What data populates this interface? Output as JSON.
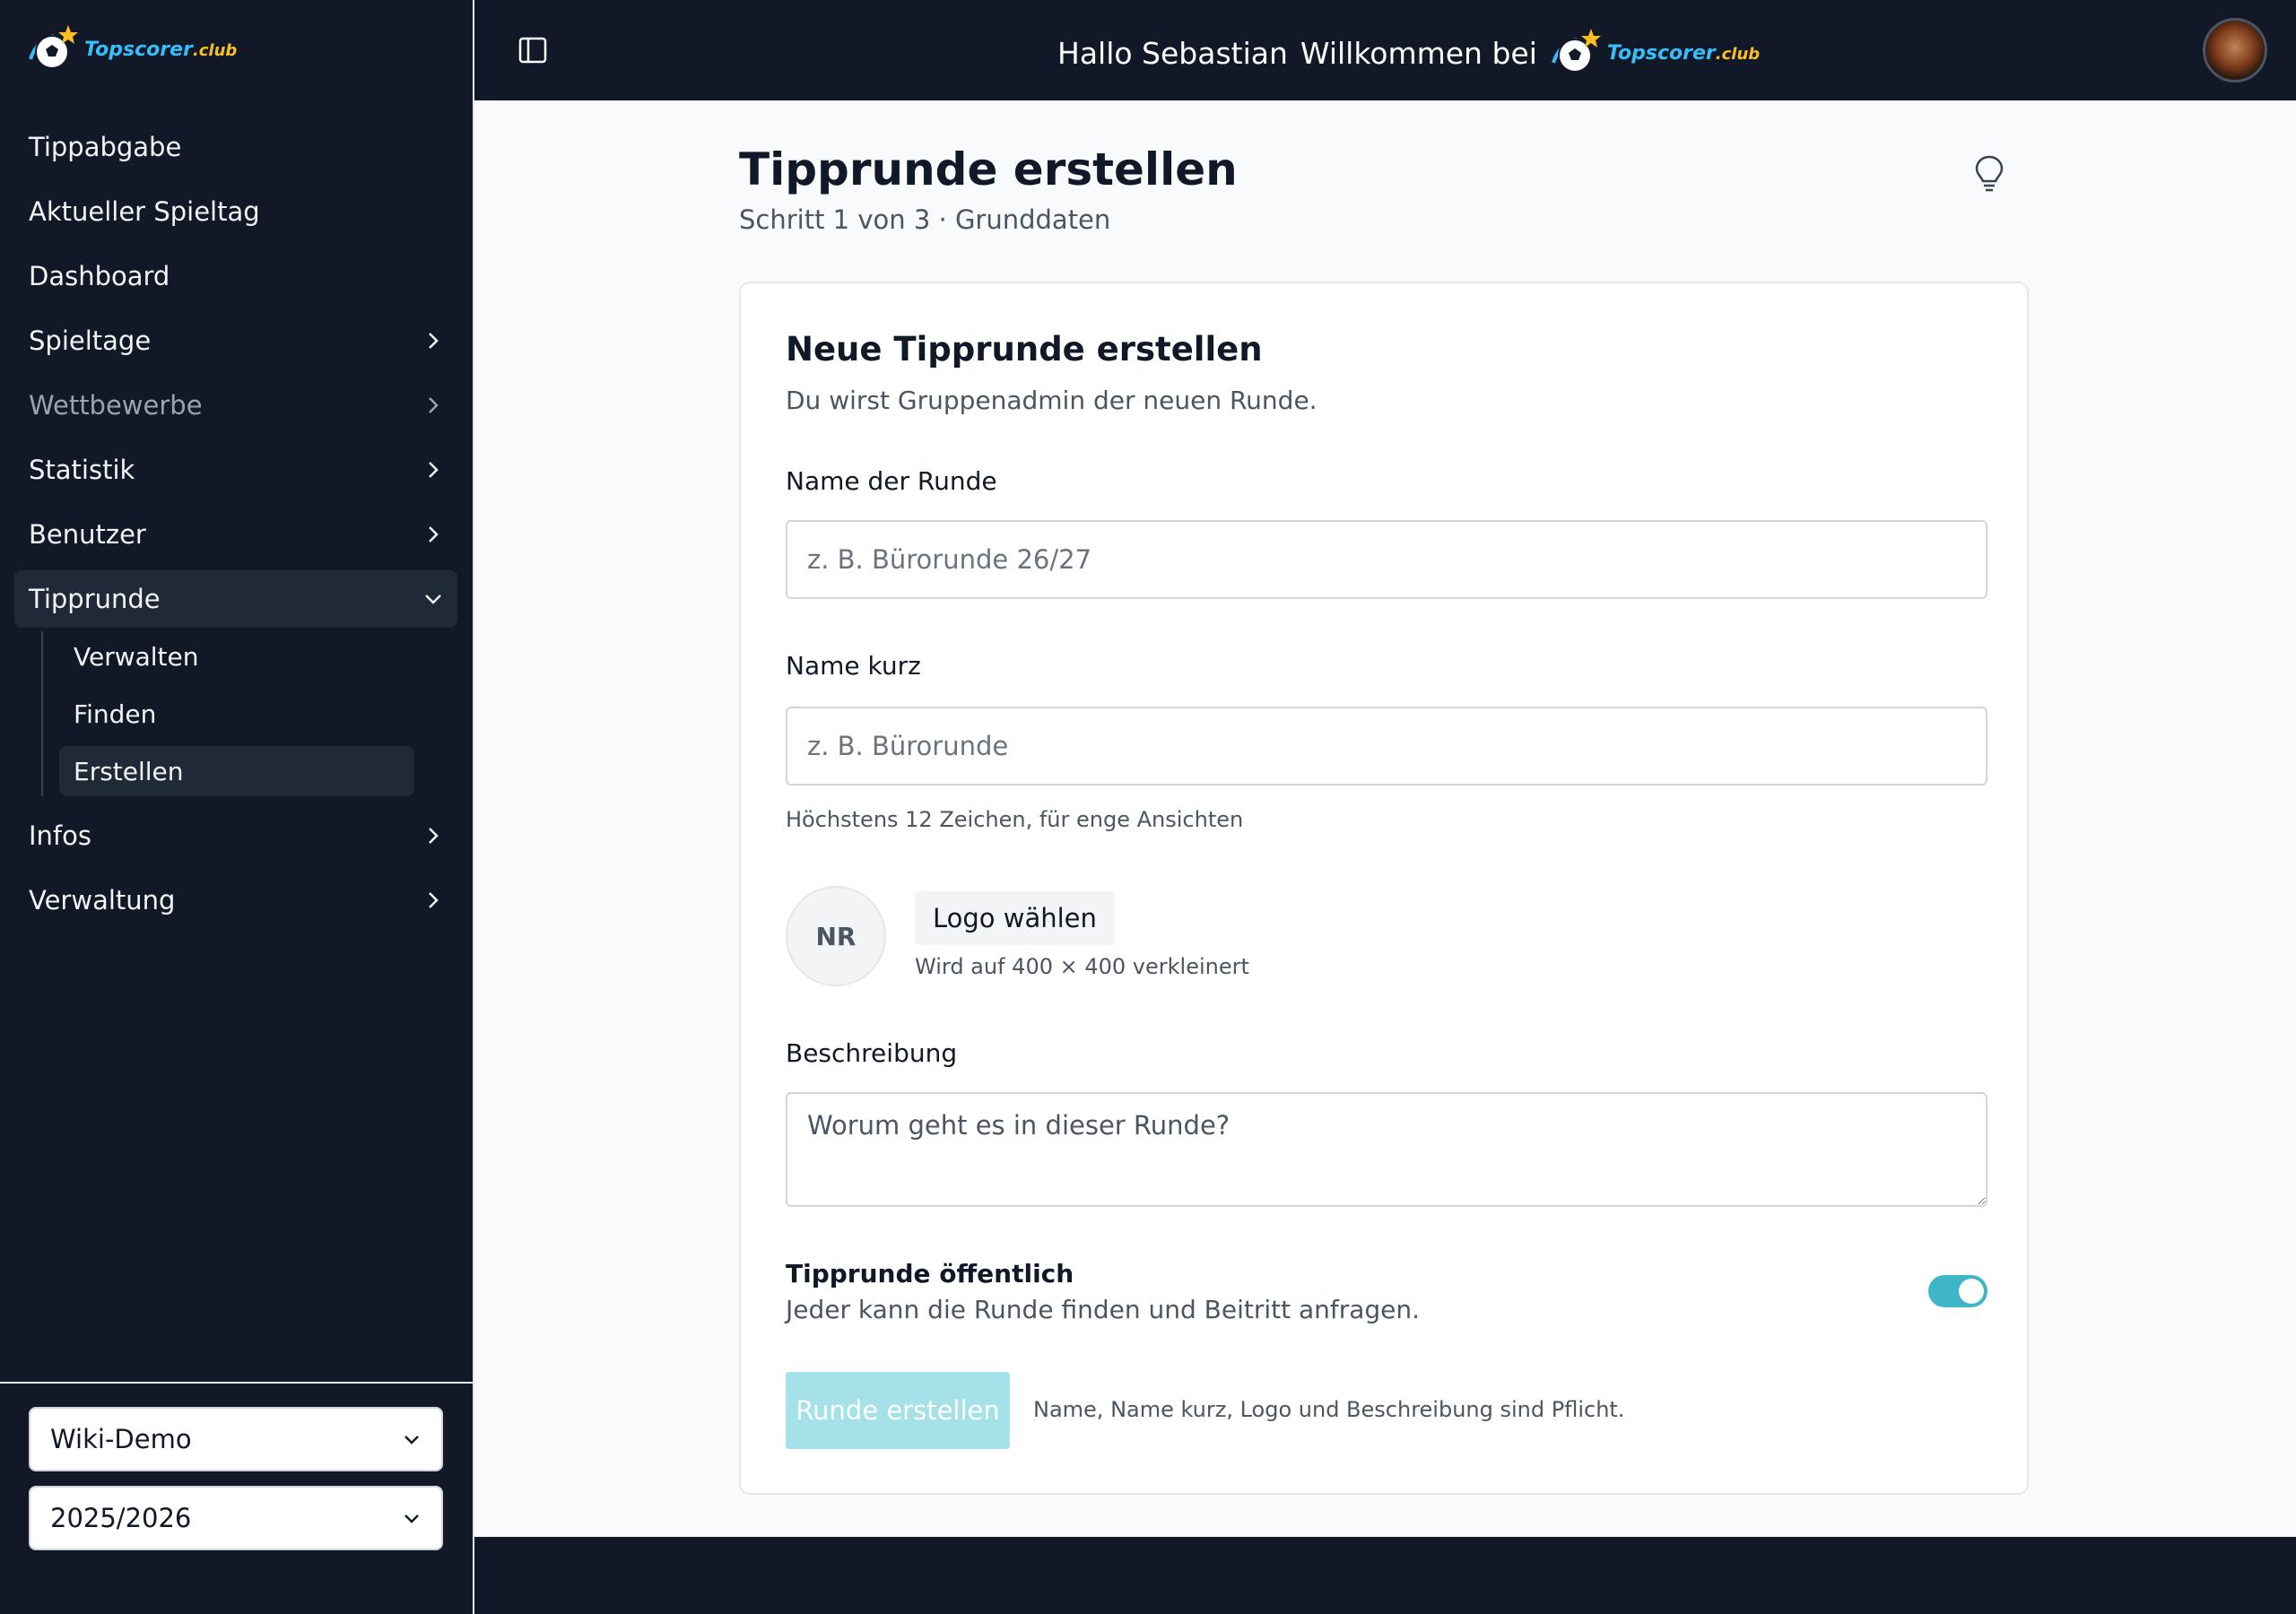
{
  "brand": {
    "name_part1": "Topscorer",
    "name_part2": ".club"
  },
  "sidebar": {
    "items": [
      {
        "label": "Tippabgabe",
        "chevron": false
      },
      {
        "label": "Aktueller Spieltag",
        "chevron": false
      },
      {
        "label": "Dashboard",
        "chevron": false
      },
      {
        "label": "Spieltage",
        "chevron": true
      },
      {
        "label": "Wettbewerbe",
        "chevron": true,
        "disabled": true
      },
      {
        "label": "Statistik",
        "chevron": true
      },
      {
        "label": "Benutzer",
        "chevron": true
      },
      {
        "label": "Tipprunde",
        "chevron": true,
        "expanded": true
      }
    ],
    "subitems": [
      {
        "label": "Verwalten"
      },
      {
        "label": "Finden"
      },
      {
        "label": "Erstellen",
        "active": true
      }
    ],
    "items_after": [
      {
        "label": "Infos",
        "chevron": true
      },
      {
        "label": "Verwaltung",
        "chevron": true
      }
    ],
    "group_select": "Wiki-Demo",
    "season_select": "2025/2026"
  },
  "header": {
    "greeting": "Hallo Sebastian",
    "welcome": "Willkommen bei"
  },
  "page": {
    "title": "Tipprunde erstellen",
    "step": "Schritt 1 von 3 · Grunddaten"
  },
  "card": {
    "title": "Neue Tipprunde erstellen",
    "subtitle": "Du wirst Gruppenadmin der neuen Runde.",
    "name_label": "Name der Runde",
    "name_placeholder": "z. B. Bürorunde 26/27",
    "short_label": "Name kurz",
    "short_placeholder": "z. B. Bürorunde",
    "short_hint": "Höchstens 12 Zeichen, für enge Ansichten",
    "logo_initials": "NR",
    "logo_button": "Logo wählen",
    "logo_hint": "Wird auf 400 × 400 verkleinert",
    "desc_label": "Beschreibung",
    "desc_placeholder": "Worum geht es in dieser Runde?",
    "public_title": "Tipprunde öffentlich",
    "public_desc": "Jeder kann die Runde finden und Beitritt anfragen.",
    "public_on": true,
    "submit_label": "Runde erstellen",
    "submit_hint": "Name, Name kurz, Logo und Beschreibung sind Pflicht."
  },
  "colors": {
    "sidebar_bg": "#111827",
    "accent": "#3fb6c8",
    "submit_disabled": "#a5e1e8"
  }
}
